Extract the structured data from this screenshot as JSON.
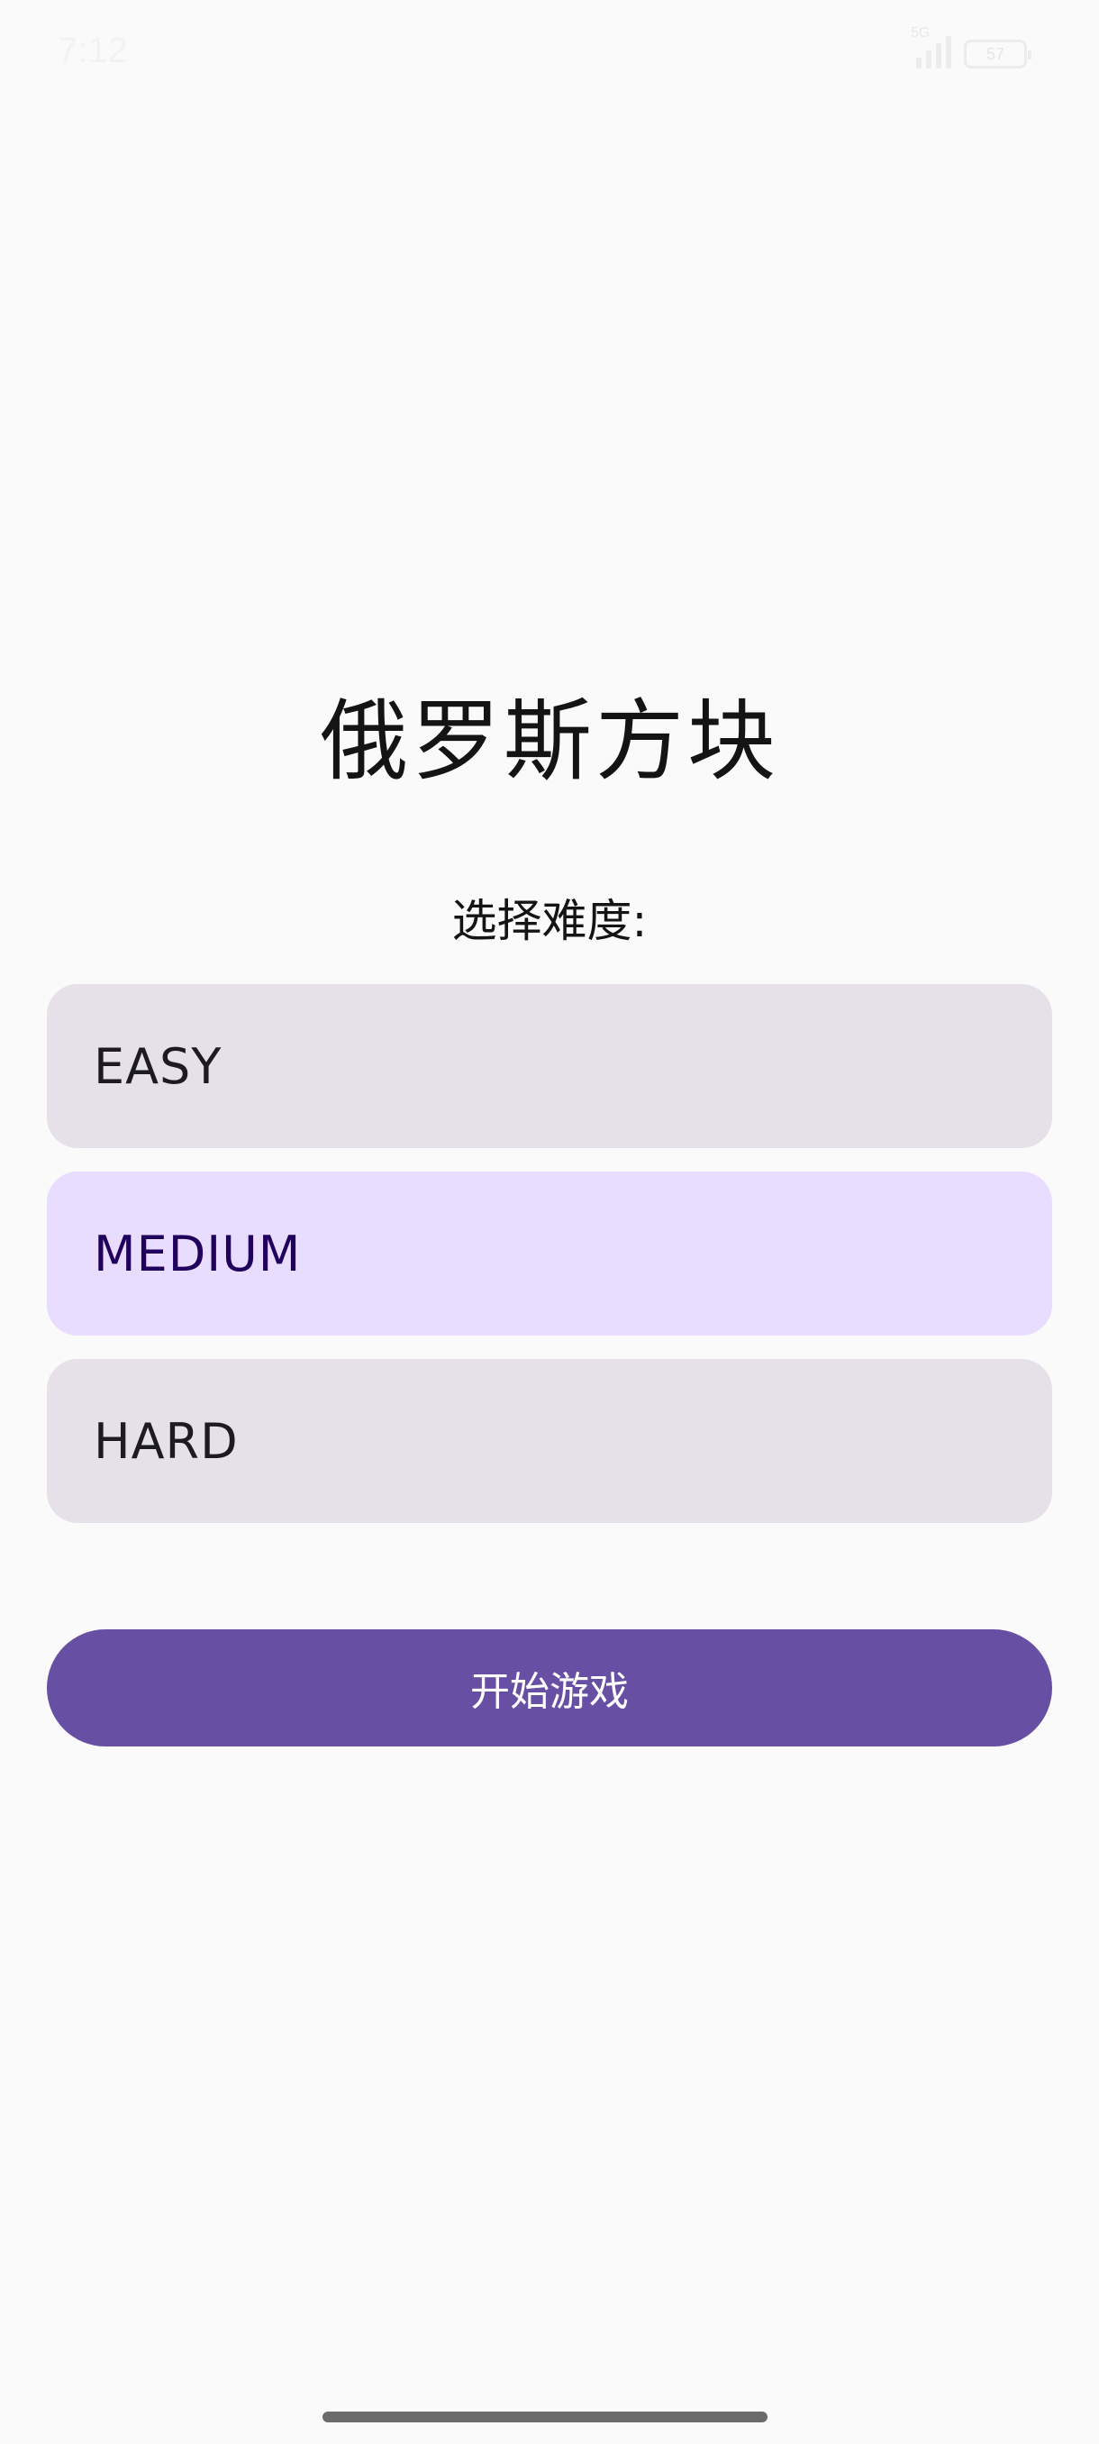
{
  "status_bar": {
    "time": "7:12",
    "network": "5G",
    "battery": "57"
  },
  "app": {
    "title": "俄罗斯方块",
    "difficulty_prompt": "选择难度:",
    "options": [
      {
        "label": "EASY",
        "selected": false
      },
      {
        "label": "MEDIUM",
        "selected": true
      },
      {
        "label": "HARD",
        "selected": false
      }
    ],
    "start_label": "开始游戏"
  },
  "colors": {
    "primary": "#6750a4",
    "option_bg": "#e6e0e8",
    "option_selected_bg": "#e9ddff",
    "background": "#fafafa"
  }
}
